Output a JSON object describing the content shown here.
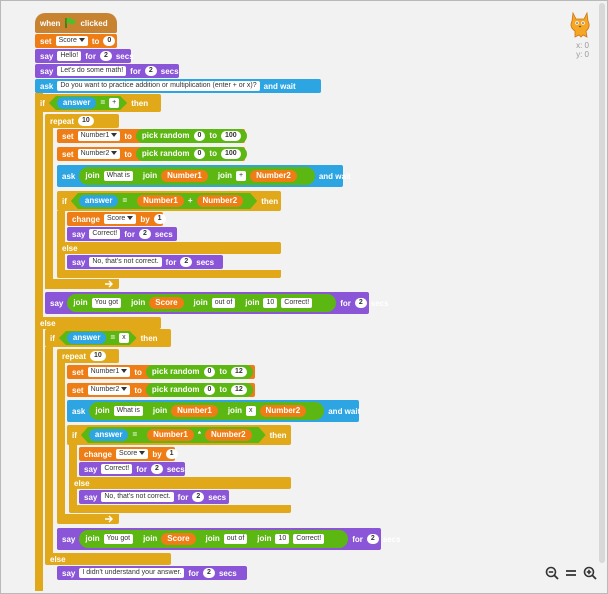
{
  "script": {
    "when_text": "when",
    "clicked_text": "clicked",
    "set": "set",
    "to": "to",
    "say": "say",
    "for": "for",
    "secs": "secs",
    "ask": "ask",
    "and_wait": "and wait",
    "if": "if",
    "then": "then",
    "else": "else",
    "repeat": "repeat",
    "pick_random": "pick random",
    "join": "join",
    "change": "change",
    "by": "by",
    "answer": "answer",
    "eq": "=",
    "plus": "+",
    "times": "*",
    "var_score": "Score",
    "var_n1": "Number1",
    "var_n2": "Number2",
    "zero": "0",
    "two": "2",
    "one": "1",
    "ten": "10",
    "hundred": "100",
    "twelve": "12",
    "hello": "Hello!",
    "lets_math": "Let's do some math!",
    "question": "Do you want to practice addition or multiplication (enter + or x)?",
    "plus_txt": "+",
    "x_txt": "x",
    "what_is": "What is",
    "correct": "Correct!",
    "not_correct": "No, that's not correct.",
    "you_got": "You got",
    "out_of": "out of",
    "didnt_understand": "I didn't understand your answer."
  },
  "sprite": {
    "x_label": "x: 0",
    "y_label": "y: 0"
  },
  "colors": {
    "events": "#c88330",
    "variables": "#ee7d16",
    "looks": "#8a55d7",
    "sensing": "#2ca5e2",
    "control": "#e1a91a",
    "operators": "#5cb712"
  },
  "icons": {
    "flag": "green-flag-icon",
    "sprite": "cat-sprite-icon",
    "zoom_out": "zoom-out-icon",
    "zoom_reset": "zoom-reset-icon",
    "zoom_in": "zoom-in-icon"
  }
}
